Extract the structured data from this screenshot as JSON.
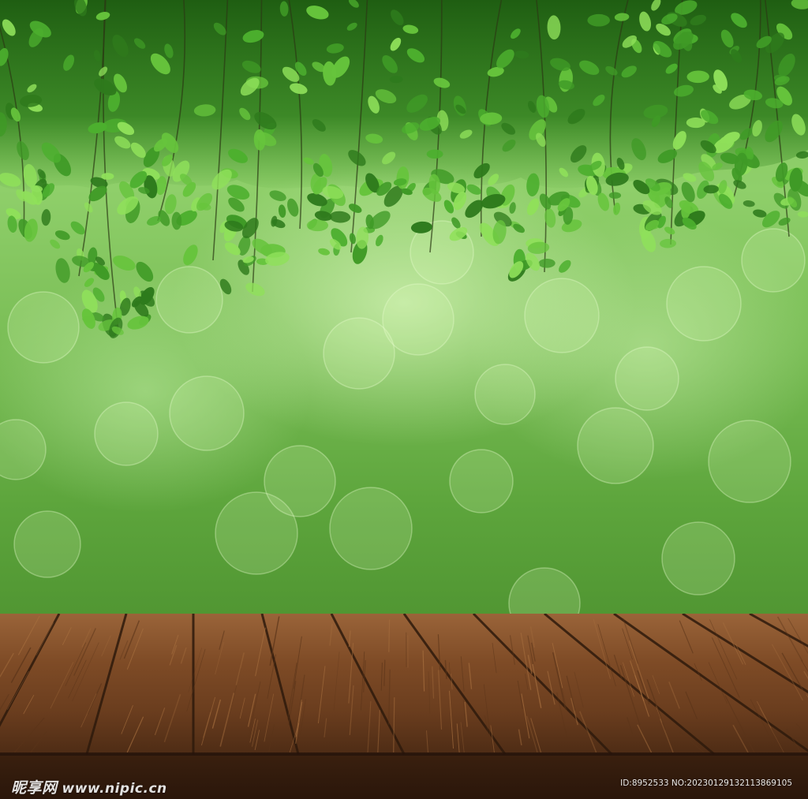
{
  "scene": {
    "palette": {
      "leaf_dark": "#2e7a1c",
      "leaf_mid": "#4caf2e",
      "leaf_light": "#8fe05a",
      "wood_light": "#8a5632",
      "wood_dark": "#4a2a14"
    }
  },
  "watermark": {
    "brand": "昵享网",
    "site": "www.nipic.cn",
    "id_text": "ID:8952533 NO:20230129132113869105"
  }
}
